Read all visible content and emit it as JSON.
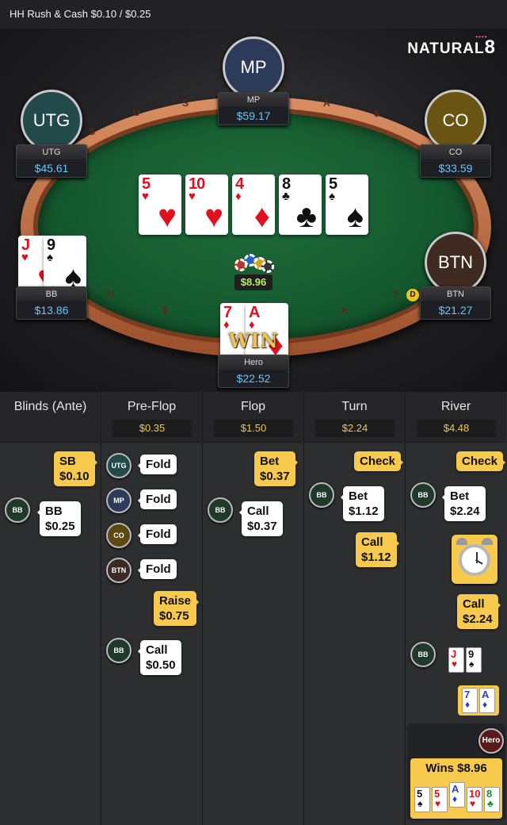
{
  "header": {
    "title": "HH  Rush & Cash $0.10 / $0.25"
  },
  "brand": {
    "name": "NATURAL",
    "digit": "8",
    "dots": "••••"
  },
  "seats": {
    "mp": {
      "label": "MP",
      "name": "MP",
      "stack": "$59.17",
      "color": "#2c3b5a"
    },
    "utg": {
      "label": "UTG",
      "name": "UTG",
      "stack": "$45.61",
      "color": "#234a4a"
    },
    "co": {
      "label": "CO",
      "name": "CO",
      "stack": "$33.59",
      "color": "#6a5412"
    },
    "bb": {
      "name": "BB",
      "stack": "$13.86"
    },
    "btn": {
      "label": "BTN",
      "name": "BTN",
      "stack": "$21.27",
      "color": "#3f2a20"
    },
    "hero": {
      "name": "Hero",
      "stack": "$22.52"
    }
  },
  "board": [
    {
      "rank": "5",
      "suit": "♥",
      "color": "red"
    },
    {
      "rank": "10",
      "suit": "♥",
      "color": "red"
    },
    {
      "rank": "4",
      "suit": "♦",
      "color": "red"
    },
    {
      "rank": "8",
      "suit": "♣",
      "color": "blk"
    },
    {
      "rank": "5",
      "suit": "♠",
      "color": "blk"
    }
  ],
  "bb_cards": [
    {
      "rank": "J",
      "suit": "♥",
      "color": "red"
    },
    {
      "rank": "9",
      "suit": "♠",
      "color": "blk"
    }
  ],
  "hero_cards": [
    {
      "rank": "7",
      "suit": "♦",
      "color": "red"
    },
    {
      "rank": "A",
      "suit": "♦",
      "color": "red"
    }
  ],
  "pot": "$8.96",
  "dealer": "D",
  "win_label": "WIN",
  "rail_text": [
    "S",
    "U",
    "A",
    "$",
    "S",
    "U",
    "$",
    "A",
    "S"
  ],
  "streets": [
    {
      "title": "Blinds (Ante)",
      "pot": ""
    },
    {
      "title": "Pre-Flop",
      "pot": "$0.35"
    },
    {
      "title": "Flop",
      "pot": "$1.50"
    },
    {
      "title": "Turn",
      "pot": "$2.24"
    },
    {
      "title": "River",
      "pot": "$4.48"
    }
  ],
  "actions": {
    "blinds": [
      {
        "a": "SB",
        "v": "$0.10"
      },
      {
        "a": "BB",
        "v": "$0.25"
      }
    ],
    "preflop": [
      {
        "a": "Fold",
        "v": "",
        "pos": "UTG"
      },
      {
        "a": "Fold",
        "v": "",
        "pos": "MP"
      },
      {
        "a": "Fold",
        "v": "",
        "pos": "CO"
      },
      {
        "a": "Fold",
        "v": "",
        "pos": "BTN"
      },
      {
        "a": "Raise",
        "v": "$0.75"
      },
      {
        "a": "Call",
        "v": "$0.50",
        "pos": "BB"
      }
    ],
    "flop": [
      {
        "a": "Bet",
        "v": "$0.37"
      },
      {
        "a": "Call",
        "v": "$0.37",
        "pos": "BB"
      }
    ],
    "turn": [
      {
        "a": "Check",
        "v": ""
      },
      {
        "a": "Bet",
        "v": "$1.12",
        "pos": "BB"
      },
      {
        "a": "Call",
        "v": "$1.12"
      }
    ],
    "river": [
      {
        "a": "Check",
        "v": ""
      },
      {
        "a": "Bet",
        "v": "$2.24",
        "pos": "BB"
      },
      {
        "a": "Call",
        "v": "$2.24"
      }
    ]
  },
  "river_show": {
    "bb_pos": "BB",
    "bb_cards": [
      {
        "rank": "J",
        "suit": "♥",
        "color": "red"
      },
      {
        "rank": "9",
        "suit": "♠",
        "color": "blk"
      }
    ],
    "hero_cards": [
      {
        "rank": "7",
        "suit": "♦",
        "color": "blue"
      },
      {
        "rank": "A",
        "suit": "♦",
        "color": "blue"
      }
    ],
    "hero_label": "Hero",
    "wins": "Wins $8.96",
    "best_hand": [
      {
        "rank": "5",
        "suit": "♠",
        "color": "blk"
      },
      {
        "rank": "5",
        "suit": "♥",
        "color": "red"
      },
      {
        "rank": "A",
        "suit": "♦",
        "color": "blue"
      },
      {
        "rank": "10",
        "suit": "♥",
        "color": "red"
      },
      {
        "rank": "8",
        "suit": "♣",
        "color": "grn"
      }
    ]
  },
  "pos_colors": {
    "UTG": "#234a4a",
    "MP": "#2c3b5a",
    "CO": "#5d4a12",
    "BTN": "#3a2a22",
    "BB": "#1f3a2a",
    "Hero": "#5a1a1a"
  }
}
